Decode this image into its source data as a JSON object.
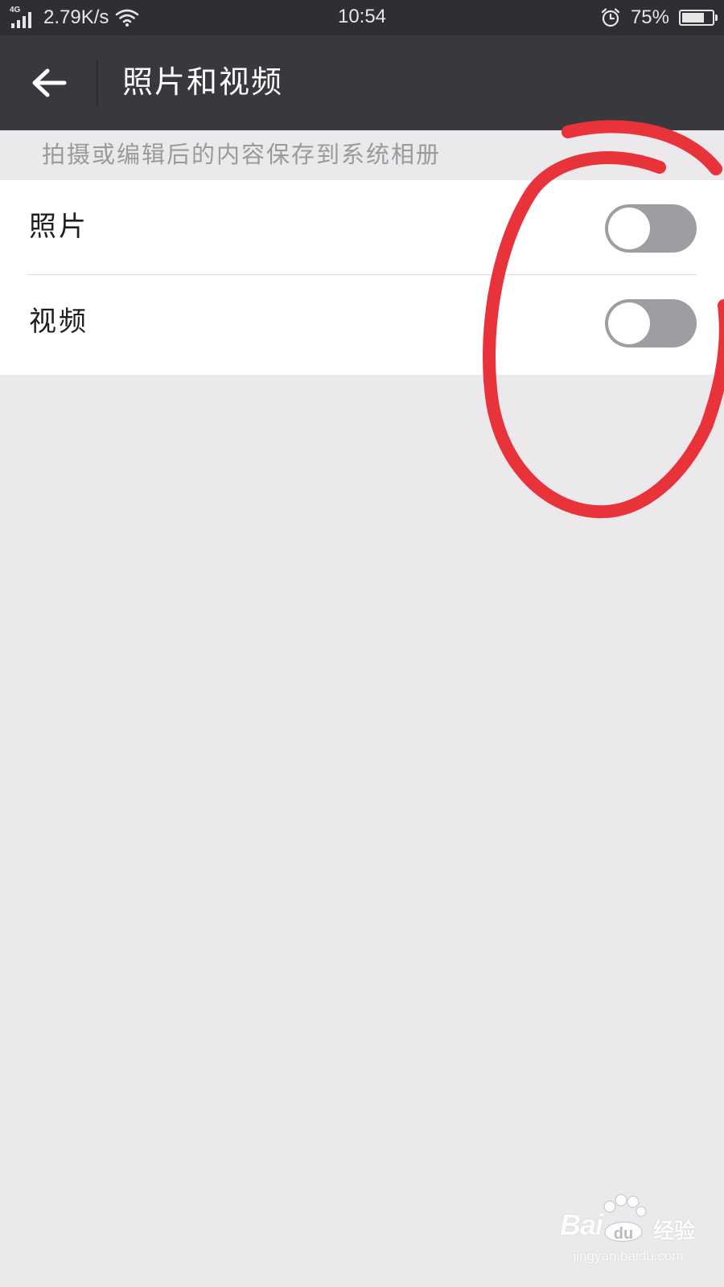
{
  "status_bar": {
    "network_type": "4G",
    "network_speed": "2.79K/s",
    "time": "10:54",
    "battery_percent": "75%",
    "battery_level": 0.75
  },
  "header": {
    "back_icon": "arrow-left-icon",
    "title": "照片和视频"
  },
  "section": {
    "hint": "拍摄或编辑后的内容保存到系统相册"
  },
  "settings": {
    "items": [
      {
        "label": "照片",
        "enabled": false
      },
      {
        "label": "视频",
        "enabled": false
      }
    ]
  },
  "annotation": {
    "color": "#e8333a",
    "shape": "hand-drawn-circle"
  },
  "watermark": {
    "brand": "Bai",
    "brand_paw": "du",
    "suffix": "经验",
    "url": "jingyan.baidu.com"
  },
  "colors": {
    "status_bar": "#2f2f33",
    "app_bar": "#38383d",
    "page_background": "#ebe9ec",
    "toggle_off": "#9e9da1"
  }
}
